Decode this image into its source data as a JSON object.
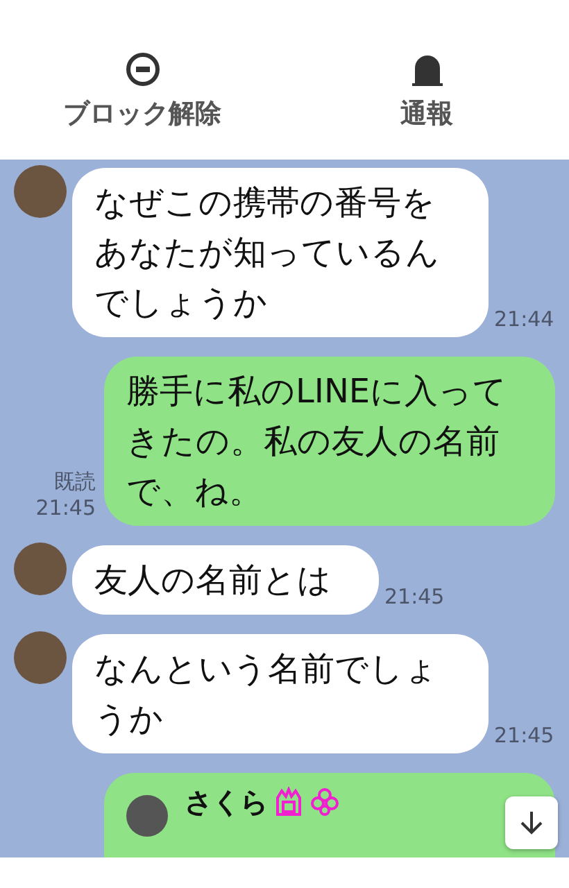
{
  "header": {
    "actions": [
      {
        "kind": "unblock",
        "label": "ブロック解除"
      },
      {
        "kind": "report",
        "label": "通報"
      }
    ]
  },
  "messages": [
    {
      "kind": "received",
      "text": "なぜこの携帯の番号をあなたが知っているんでしょうか",
      "time": "21:44"
    },
    {
      "kind": "sent",
      "text": "勝手に私のLINEに入ってきたの。私の友人の名前で、ね。",
      "read": "既読",
      "time": "21:45"
    },
    {
      "kind": "received",
      "text": "友人の名前とは",
      "time": "21:45"
    },
    {
      "kind": "received",
      "text": "なんという名前でしょうか",
      "time": "21:45"
    },
    {
      "kind": "contact",
      "name": "さくら"
    }
  ]
}
